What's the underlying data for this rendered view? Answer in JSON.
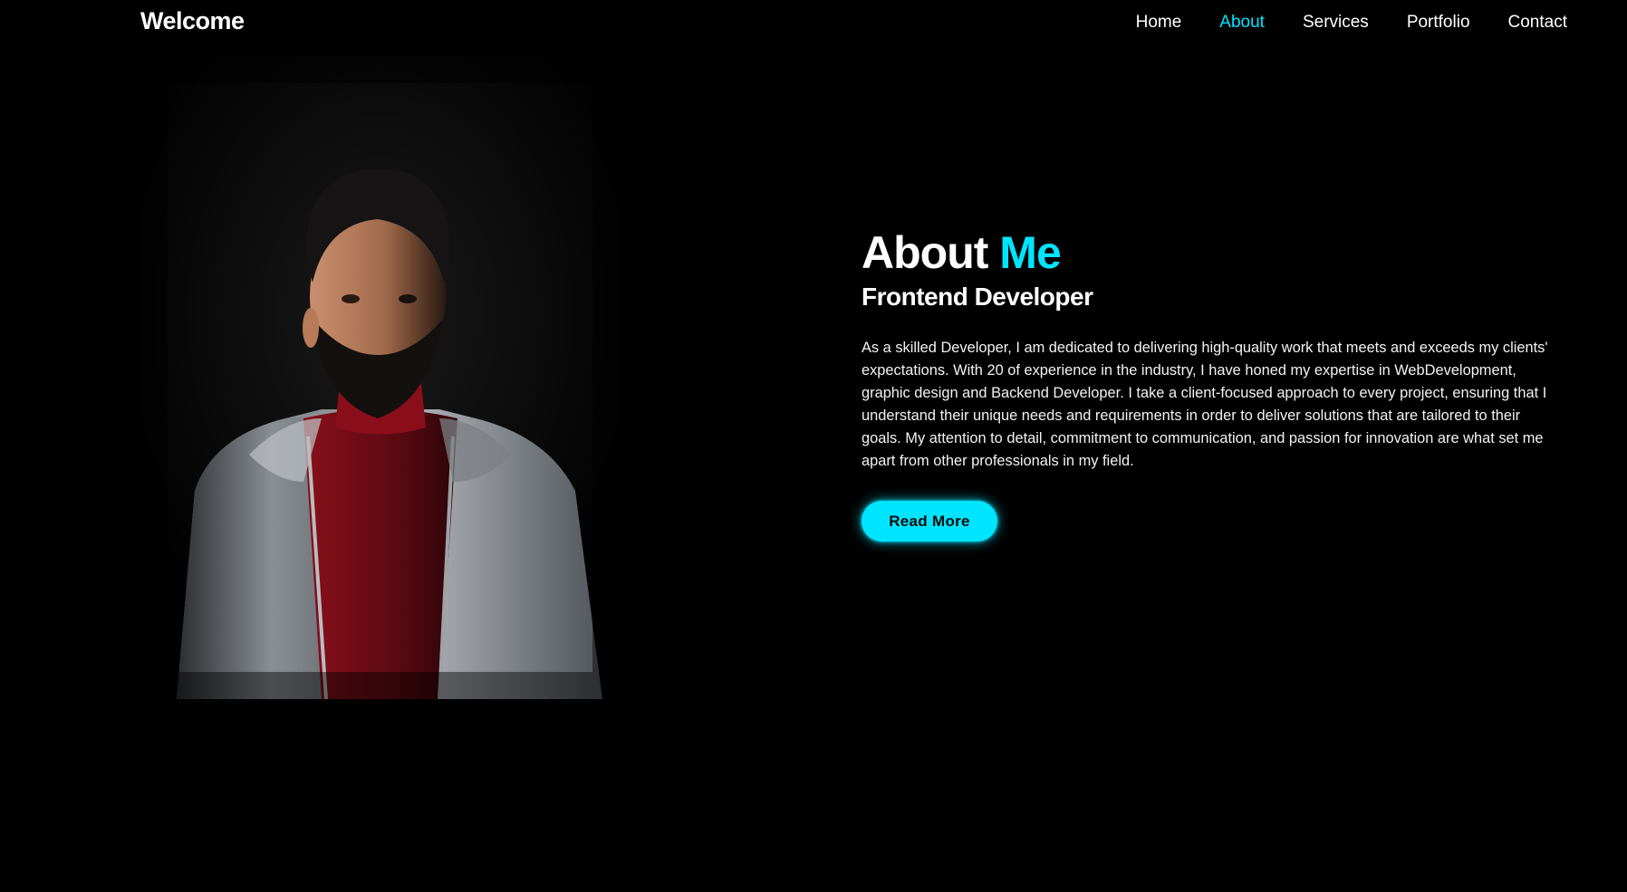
{
  "header": {
    "logo": "Welcome",
    "nav": [
      {
        "label": "Home",
        "active": false
      },
      {
        "label": "About",
        "active": true
      },
      {
        "label": "Services",
        "active": false
      },
      {
        "label": "Portfolio",
        "active": false
      },
      {
        "label": "Contact",
        "active": false
      }
    ]
  },
  "about": {
    "heading_main": "About",
    "heading_accent": "Me",
    "subheading": "Frontend Developer",
    "paragraph": "As a skilled Developer, I am dedicated to delivering high-quality work that meets and exceeds my clients' expectations. With 20 of experience in the industry, I have honed my expertise in WebDevelopment, graphic design and Backend Developer. I take a client-focused approach to every project, ensuring that I understand their unique needs and requirements in order to deliver solutions that are tailored to their goals. My attention to detail, commitment to communication, and passion for innovation are what set me apart from other professionals in my field.",
    "button_label": "Read More"
  },
  "colors": {
    "background": "#000000",
    "accent": "#00e5ff",
    "text": "#ffffff"
  },
  "icons": {
    "portrait": "profile-photo"
  }
}
